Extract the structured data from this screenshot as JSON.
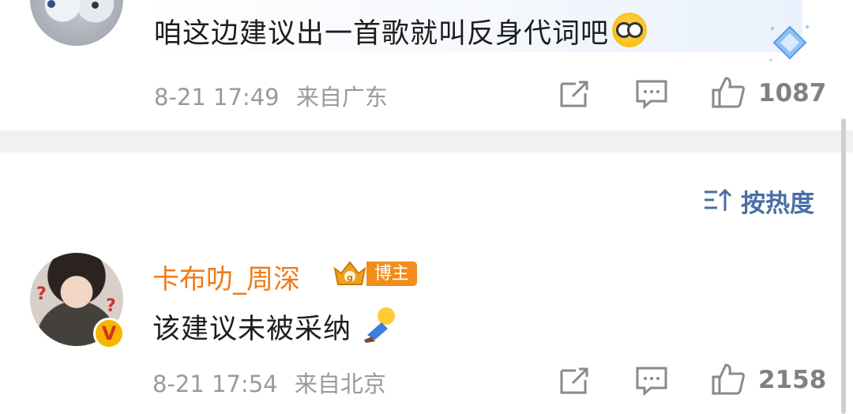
{
  "comments": [
    {
      "text": "咱这边建议出一首歌就叫反身代词吧",
      "emoji": "glasses-face-icon",
      "time": "8-21 17:49",
      "location": "来自广东",
      "likes": "1087"
    },
    {
      "username": "卡布叻_周深",
      "badge": "博主",
      "text": "该建议未被采纳",
      "emoji": "sleeping-person-icon",
      "time": "8-21 17:54",
      "location": "来自北京",
      "likes": "2158"
    }
  ],
  "sort": {
    "label": "按热度",
    "icon": "sort-icon"
  },
  "colors": {
    "username": "#f07a16",
    "sort": "#4a6fa5",
    "meta": "#9a9a9a",
    "badge": "#f28c1b",
    "separator": "#f1f1f1"
  }
}
